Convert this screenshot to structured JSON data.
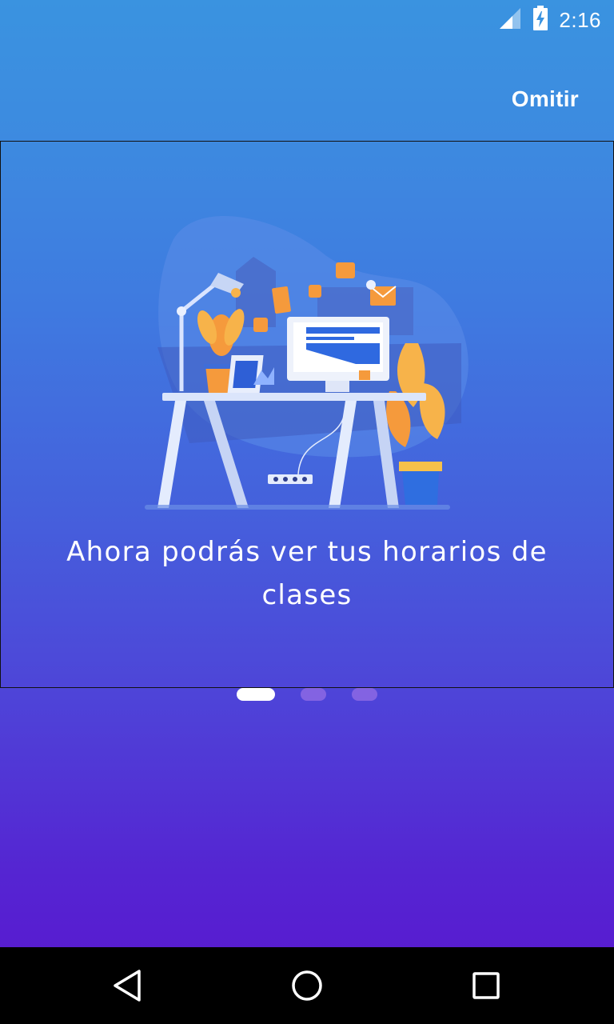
{
  "status_bar": {
    "time": "2:16",
    "icons": [
      "cell-signal-icon",
      "battery-charging-icon"
    ]
  },
  "top_bar": {
    "skip_label": "Omitir"
  },
  "slides": [
    {
      "illustration": "desk-workspace-illustration",
      "text": "Ahora podrás ver tus horarios de clases"
    }
  ],
  "pager": {
    "page_count": 3,
    "current_page": 1
  },
  "nav_bar": {
    "icons": [
      "back-icon",
      "home-icon",
      "recents-icon"
    ]
  },
  "colors": {
    "gradient_top": "#3a93e0",
    "gradient_bottom": "#5a15cf",
    "accent_orange": "#f59a3c",
    "text": "#ffffff"
  }
}
